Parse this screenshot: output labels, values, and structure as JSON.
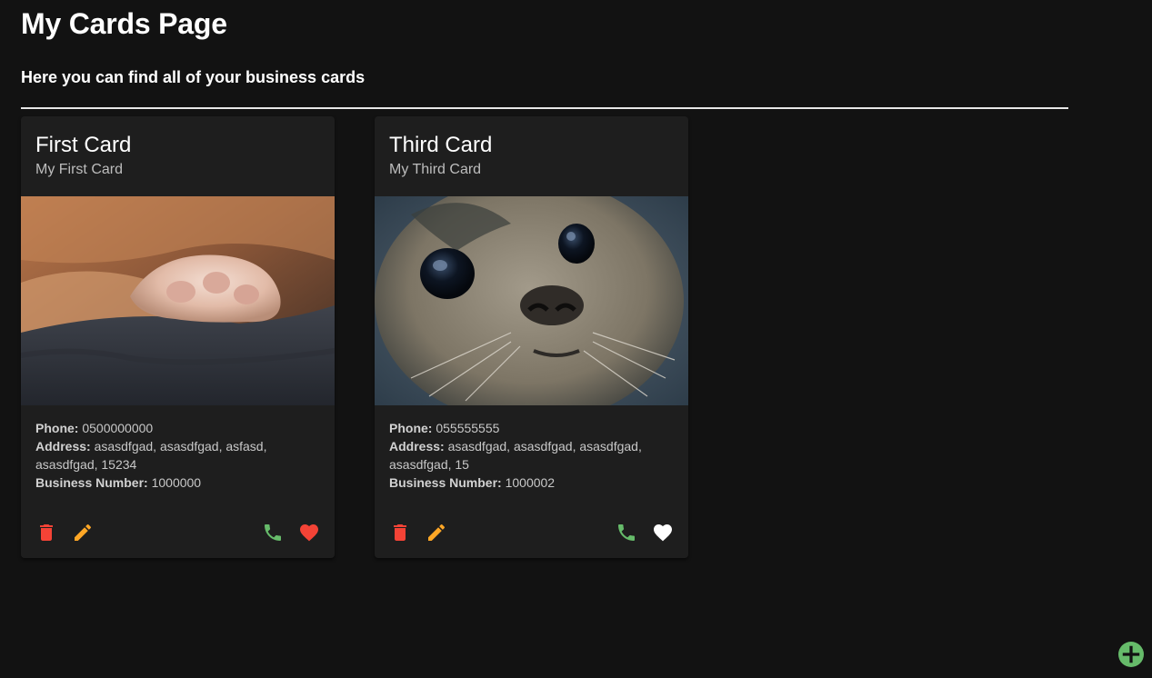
{
  "page": {
    "title": "My Cards Page",
    "subtitle": "Here you can find all of your business cards"
  },
  "labels": {
    "phone": "Phone:",
    "address": "Address:",
    "business_number": "Business Number:"
  },
  "colors": {
    "background": "#121212",
    "card": "#1e1e1e",
    "delete": "#f44336",
    "edit": "#ffa726",
    "phone": "#66bb6a",
    "like_active": "#f44336",
    "like_inactive": "#ffffff",
    "add": "#66bb6a"
  },
  "cards": [
    {
      "title": "First Card",
      "subtitle": "My First Card",
      "image": "cat-paw-photo",
      "phone": "0500000000",
      "address_line1": "asasdfgad, asasdfgad, asfasd,",
      "address_line2": "asasdfgad, 15234",
      "business_number": "1000000",
      "liked": true
    },
    {
      "title": "Third Card",
      "subtitle": "My Third Card",
      "image": "seal-photo",
      "phone": "055555555",
      "address_line1": "asasdfgad, asasdfgad, asasdfgad,",
      "address_line2": "asasdfgad, 15",
      "business_number": "1000002",
      "liked": false
    }
  ],
  "icons": {
    "delete": "trash-icon",
    "edit": "pencil-icon",
    "call": "phone-icon",
    "like": "heart-icon",
    "add": "plus-circle-icon"
  }
}
